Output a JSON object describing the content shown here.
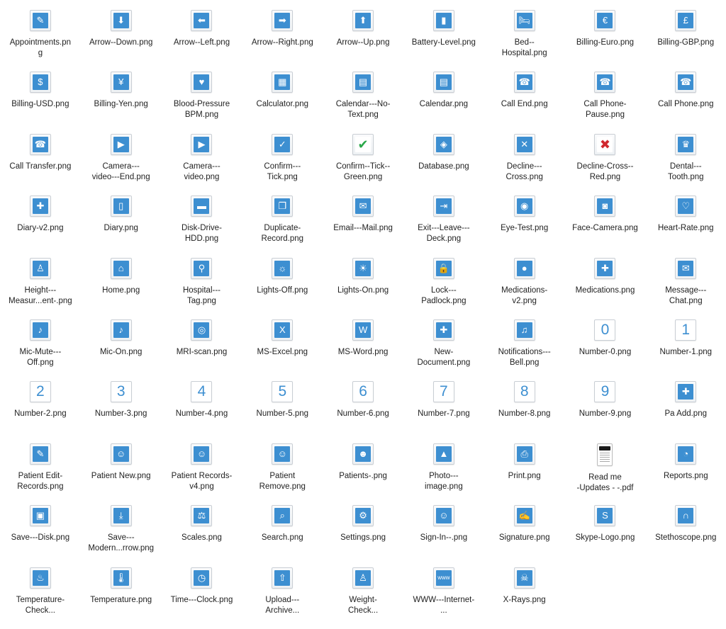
{
  "window": {
    "title": ""
  },
  "accent_color": "#3d8fd1",
  "files": [
    {
      "name": "Appointments.pn\ng",
      "icon": "clipboard-icon",
      "glyph": "✎"
    },
    {
      "name": "Arrow--Down.png",
      "icon": "arrow-down-icon",
      "glyph": "⬇"
    },
    {
      "name": "Arrow--Left.png",
      "icon": "arrow-left-icon",
      "glyph": "⬅"
    },
    {
      "name": "Arrow--Right.png",
      "icon": "arrow-right-icon",
      "glyph": "➡"
    },
    {
      "name": "Arrow--Up.png",
      "icon": "arrow-up-icon",
      "glyph": "⬆"
    },
    {
      "name": "Battery-Level.png",
      "icon": "battery-icon",
      "glyph": "▮"
    },
    {
      "name": "Bed--\nHospital.png",
      "icon": "hospital-bed-icon",
      "glyph": "🛏"
    },
    {
      "name": "Billing-Euro.png",
      "icon": "euro-icon",
      "glyph": "€"
    },
    {
      "name": "Billing-GBP.png",
      "icon": "pound-icon",
      "glyph": "£"
    },
    {
      "name": "Billing-USD.png",
      "icon": "dollar-icon",
      "glyph": "$"
    },
    {
      "name": "Billing-Yen.png",
      "icon": "yen-icon",
      "glyph": "¥"
    },
    {
      "name": "Blood-Pressure\nBPM.png",
      "icon": "heart-monitor-icon",
      "glyph": "♥"
    },
    {
      "name": "Calculator.png",
      "icon": "calculator-icon",
      "glyph": "▦"
    },
    {
      "name": "Calendar---No-\nText.png",
      "icon": "calendar-icon",
      "glyph": "▤"
    },
    {
      "name": "Calendar.png",
      "icon": "calendar-icon",
      "glyph": "▤"
    },
    {
      "name": "Call End.png",
      "icon": "phone-end-icon",
      "glyph": "☎"
    },
    {
      "name": "Call Phone-\nPause.png",
      "icon": "phone-pause-icon",
      "glyph": "☎"
    },
    {
      "name": "Call Phone.png",
      "icon": "phone-icon",
      "glyph": "☎"
    },
    {
      "name": "Call Transfer.png",
      "icon": "phone-transfer-icon",
      "glyph": "☎"
    },
    {
      "name": "Camera---\nvideo---End.png",
      "icon": "video-off-icon",
      "glyph": "▶"
    },
    {
      "name": "Camera---\nvideo.png",
      "icon": "video-camera-icon",
      "glyph": "▶"
    },
    {
      "name": "Confirm---\nTick.png",
      "icon": "checkmark-icon",
      "glyph": "✓"
    },
    {
      "name": "Confirm--Tick--\nGreen.png",
      "icon": "checkmark-green-icon",
      "glyph": "✔"
    },
    {
      "name": "Database.png",
      "icon": "database-icon",
      "glyph": "◈"
    },
    {
      "name": "Decline---\nCross.png",
      "icon": "cross-icon",
      "glyph": "✕"
    },
    {
      "name": "Decline-Cross--\nRed.png",
      "icon": "cross-red-icon",
      "glyph": "✖"
    },
    {
      "name": "Dental---\nTooth.png",
      "icon": "tooth-icon",
      "glyph": "♛"
    },
    {
      "name": "Diary-v2.png",
      "icon": "diary-icon",
      "glyph": "✚"
    },
    {
      "name": "Diary.png",
      "icon": "diary-icon",
      "glyph": "▯"
    },
    {
      "name": "Disk-Drive-\nHDD.png",
      "icon": "hard-drive-icon",
      "glyph": "▬"
    },
    {
      "name": "Duplicate-\nRecord.png",
      "icon": "duplicate-icon",
      "glyph": "❐"
    },
    {
      "name": "Email---Mail.png",
      "icon": "envelope-icon",
      "glyph": "✉"
    },
    {
      "name": "Exit---Leave---\nDeck.png",
      "icon": "exit-icon",
      "glyph": "⇥"
    },
    {
      "name": "Eye-Test.png",
      "icon": "eye-icon",
      "glyph": "◉"
    },
    {
      "name": "Face-Camera.png",
      "icon": "face-camera-icon",
      "glyph": "◙"
    },
    {
      "name": "Heart-Rate.png",
      "icon": "heart-rate-icon",
      "glyph": "♡"
    },
    {
      "name": "Height---\nMeasur...ent-.png",
      "icon": "height-icon",
      "glyph": "♙"
    },
    {
      "name": "Home.png",
      "icon": "home-icon",
      "glyph": "⌂"
    },
    {
      "name": "Hospital---\nTag.png",
      "icon": "location-pin-icon",
      "glyph": "⚲"
    },
    {
      "name": "Lights-Off.png",
      "icon": "bulb-off-icon",
      "glyph": "☼"
    },
    {
      "name": "Lights-On.png",
      "icon": "bulb-on-icon",
      "glyph": "☀"
    },
    {
      "name": "Lock---\nPadlock.png",
      "icon": "padlock-icon",
      "glyph": "🔒"
    },
    {
      "name": "Medications-\nv2.png",
      "icon": "pills-icon",
      "glyph": "●"
    },
    {
      "name": "Medications.png",
      "icon": "medicine-bottle-icon",
      "glyph": "✚"
    },
    {
      "name": "Message---\nChat.png",
      "icon": "chat-icon",
      "glyph": "✉"
    },
    {
      "name": "Mic-Mute---\nOff.png",
      "icon": "mic-mute-icon",
      "glyph": "♪"
    },
    {
      "name": "Mic-On.png",
      "icon": "microphone-icon",
      "glyph": "♪"
    },
    {
      "name": "MRI-scan.png",
      "icon": "mri-icon",
      "glyph": "◎"
    },
    {
      "name": "MS-Excel.png",
      "icon": "excel-icon",
      "glyph": "X"
    },
    {
      "name": "MS-Word.png",
      "icon": "word-icon",
      "glyph": "W"
    },
    {
      "name": "New-\nDocument.png",
      "icon": "new-document-icon",
      "glyph": "✚"
    },
    {
      "name": "Notifications---\nBell.png",
      "icon": "bell-icon",
      "glyph": "♫"
    },
    {
      "name": "Number-0.png",
      "icon": "number-0-icon",
      "glyph": "0",
      "num": true
    },
    {
      "name": "Number-1.png",
      "icon": "number-1-icon",
      "glyph": "1",
      "num": true
    },
    {
      "name": "Number-2.png",
      "icon": "number-2-icon",
      "glyph": "2",
      "num": true
    },
    {
      "name": "Number-3.png",
      "icon": "number-3-icon",
      "glyph": "3",
      "num": true
    },
    {
      "name": "Number-4.png",
      "icon": "number-4-icon",
      "glyph": "4",
      "num": true
    },
    {
      "name": "Number-5.png",
      "icon": "number-5-icon",
      "glyph": "5",
      "num": true
    },
    {
      "name": "Number-6.png",
      "icon": "number-6-icon",
      "glyph": "6",
      "num": true
    },
    {
      "name": "Number-7.png",
      "icon": "number-7-icon",
      "glyph": "7",
      "num": true
    },
    {
      "name": "Number-8.png",
      "icon": "number-8-icon",
      "glyph": "8",
      "num": true
    },
    {
      "name": "Number-9.png",
      "icon": "number-9-icon",
      "glyph": "9",
      "num": true
    },
    {
      "name": "Pa Add.png",
      "icon": "patient-add-icon",
      "glyph": "✚"
    },
    {
      "name": "Patient Edit-\nRecords.png",
      "icon": "patient-edit-icon",
      "glyph": "✎"
    },
    {
      "name": "Patient New.png",
      "icon": "patient-new-icon",
      "glyph": "☺"
    },
    {
      "name": "Patient Records-\nv4.png",
      "icon": "patient-records-icon",
      "glyph": "☺"
    },
    {
      "name": "Patient\nRemove.png",
      "icon": "patient-remove-icon",
      "glyph": "☺"
    },
    {
      "name": "Patients-.png",
      "icon": "patients-icon",
      "glyph": "☻"
    },
    {
      "name": "Photo---\nimage.png",
      "icon": "photo-icon",
      "glyph": "▲"
    },
    {
      "name": "Print.png",
      "icon": "printer-icon",
      "glyph": "⎙"
    },
    {
      "name": "Read me\n-Updates - -.pdf",
      "icon": "pdf-document-icon",
      "glyph": "",
      "doc": true
    },
    {
      "name": "Reports.png",
      "icon": "reports-icon",
      "glyph": "◔"
    },
    {
      "name": "Save---Disk.png",
      "icon": "floppy-disk-icon",
      "glyph": "▣"
    },
    {
      "name": "Save---\nModern...rrow.png",
      "icon": "save-arrow-icon",
      "glyph": "⤓"
    },
    {
      "name": "Scales.png",
      "icon": "scales-icon",
      "glyph": "⚖"
    },
    {
      "name": "Search.png",
      "icon": "magnifier-icon",
      "glyph": "⌕"
    },
    {
      "name": "Settings.png",
      "icon": "gear-icon",
      "glyph": "⚙"
    },
    {
      "name": "Sign-In--.png",
      "icon": "sign-in-icon",
      "glyph": "☺"
    },
    {
      "name": "Signature.png",
      "icon": "signature-icon",
      "glyph": "✍"
    },
    {
      "name": "Skype-Logo.png",
      "icon": "skype-icon",
      "glyph": "S"
    },
    {
      "name": "Stethoscope.png",
      "icon": "stethoscope-icon",
      "glyph": "∩"
    },
    {
      "name": "Temperature-\nCheck...",
      "icon": "temperature-check-icon",
      "glyph": "♨"
    },
    {
      "name": "Temperature.png",
      "icon": "thermometer-icon",
      "glyph": "🌡"
    },
    {
      "name": "Time---Clock.png",
      "icon": "clock-icon",
      "glyph": "◷"
    },
    {
      "name": "Upload---\nArchive...",
      "icon": "upload-icon",
      "glyph": "⇧"
    },
    {
      "name": "Weight-\nCheck...",
      "icon": "weight-icon",
      "glyph": "♙"
    },
    {
      "name": "WWW---Internet-\n...",
      "icon": "globe-window-icon",
      "glyph": "www"
    },
    {
      "name": "X-Rays.png",
      "icon": "xray-icon",
      "glyph": "☠"
    }
  ]
}
